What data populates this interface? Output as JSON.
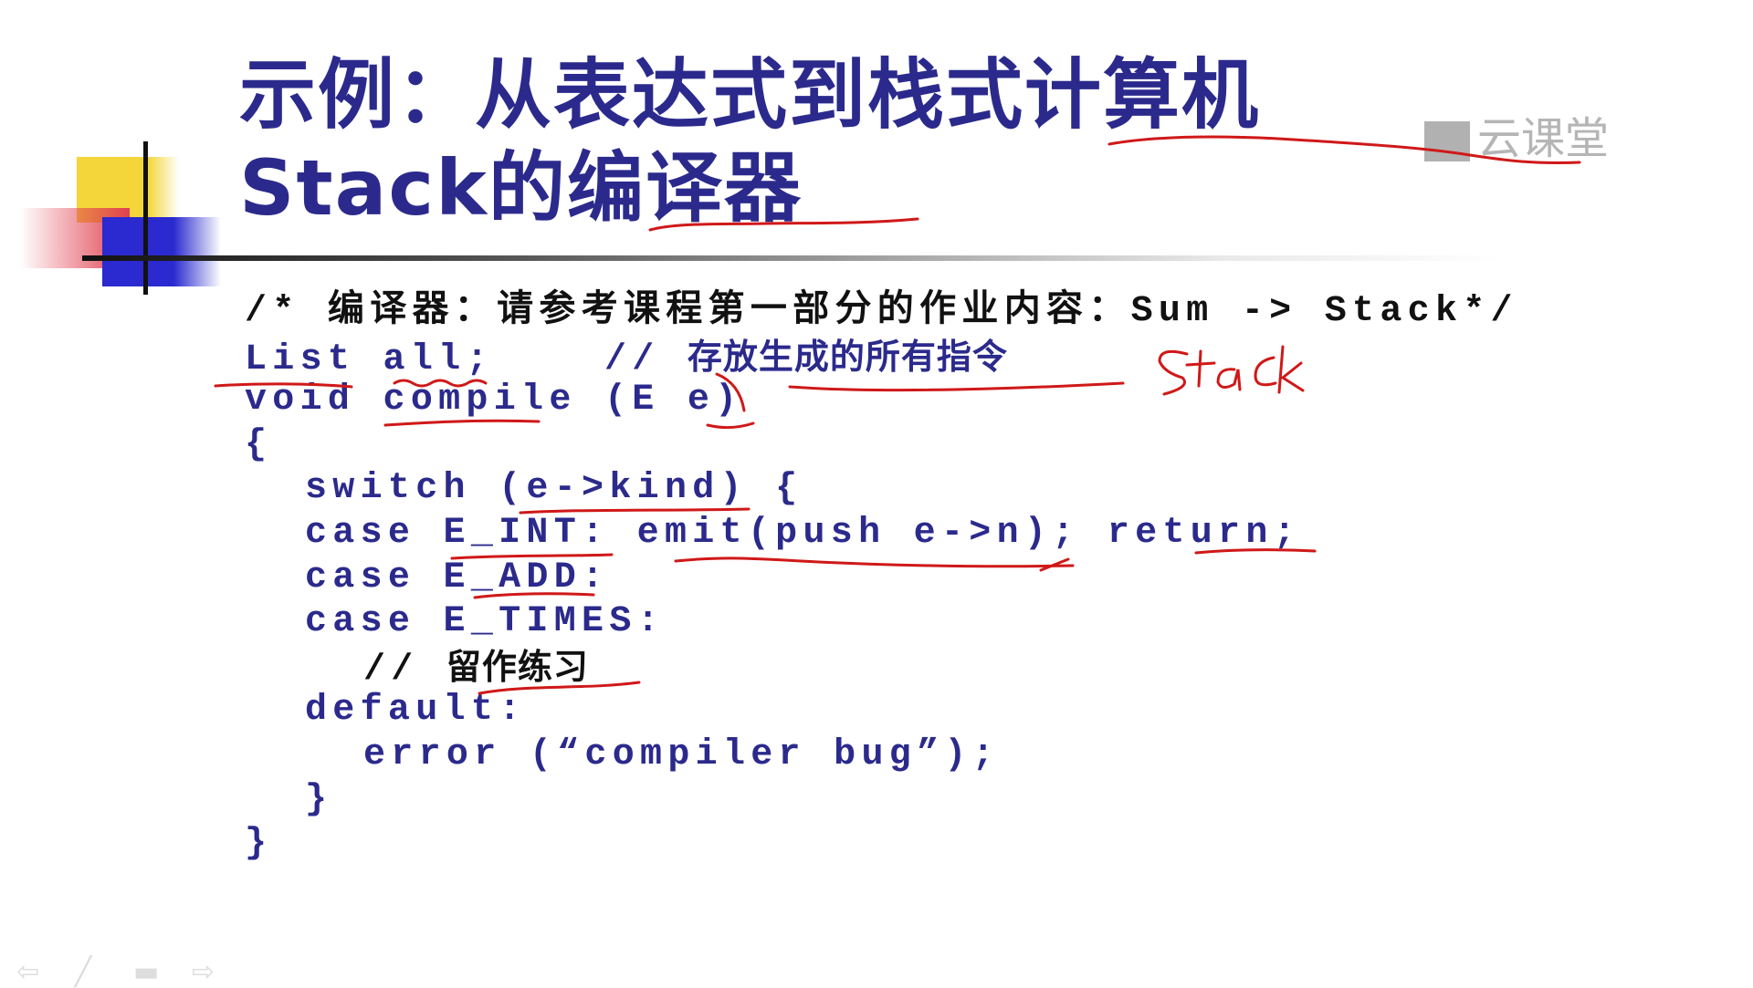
{
  "slide": {
    "title_line1": "示例：从表达式到栈式计算机",
    "title_line2": "Stack的编译器",
    "watermark": "云课堂",
    "code": [
      {
        "text": "/* 编译器：请参考课程第一部分的作业内容：Sum -> Stack*/"
      },
      {
        "a": "List all;    // ",
        "b": "存放生成的所有指令"
      },
      {
        "text": "void compile (E e)"
      },
      {
        "text": "{"
      },
      {
        "text": "switch (e->kind) {"
      },
      {
        "text": "case E_INT: emit(push e->n); return;"
      },
      {
        "text": "case E_ADD:"
      },
      {
        "text": "case E_TIMES:"
      },
      {
        "a": "// ",
        "b": "留作练习"
      },
      {
        "text": "default:"
      },
      {
        "text": "error (“compiler bug”);"
      },
      {
        "text": "}"
      },
      {
        "text": "}"
      }
    ],
    "handwriting": "Stack"
  },
  "nav": {
    "prev": "previous-slide",
    "pen": "pen-tool",
    "menu": "slide-menu",
    "next": "next-slide"
  },
  "colors": {
    "title": "#2b2a8c",
    "ink": "#d01818"
  }
}
